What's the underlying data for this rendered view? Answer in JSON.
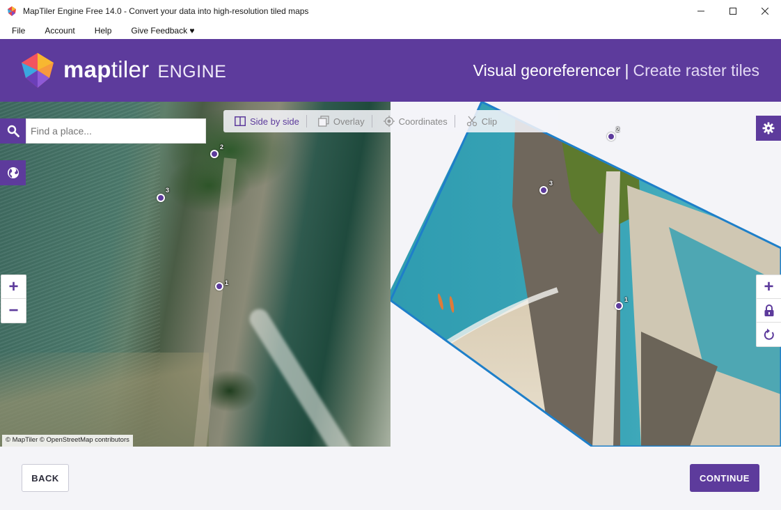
{
  "window": {
    "title": "MapTiler Engine Free 14.0 - Convert your data into high-resolution tiled maps"
  },
  "menu": {
    "file": "File",
    "account": "Account",
    "help": "Help",
    "feedback": "Give Feedback ♥"
  },
  "header": {
    "logo_bold": "map",
    "logo_light": "tiler",
    "logo_engine": "ENGINE",
    "title_main": "Visual georeferencer",
    "title_sep": "|",
    "title_sub": "Create raster tiles"
  },
  "toolbar": {
    "side_by_side": "Side by side",
    "overlay": "Overlay",
    "coordinates": "Coordinates",
    "clip": "Clip"
  },
  "search": {
    "placeholder": "Find a place..."
  },
  "zoom": {
    "in": "+",
    "out": "−"
  },
  "attribution": "© MapTiler © OpenStreetMap contributors",
  "gcps": {
    "left": [
      {
        "label": "1"
      },
      {
        "label": "2"
      },
      {
        "label": "3"
      }
    ],
    "right": [
      {
        "label": "1"
      },
      {
        "label": "2"
      },
      {
        "label": "3"
      }
    ]
  },
  "footer": {
    "back": "BACK",
    "continue": "CONTINUE"
  },
  "colors": {
    "brand": "#5d3b9c",
    "rotated_border": "#1e7fc9"
  }
}
